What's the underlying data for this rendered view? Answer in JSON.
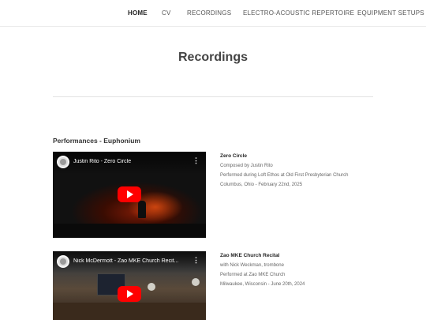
{
  "nav": {
    "items": [
      {
        "label": "HOME",
        "active": true
      },
      {
        "label": "CV",
        "active": false
      },
      {
        "label": "RECORDINGS",
        "active": false
      },
      {
        "label": "ELECTRO-ACOUSTIC REPERTOIRE",
        "active": false
      },
      {
        "label": "EQUIPMENT SETUPS",
        "active": false
      }
    ]
  },
  "page": {
    "title": "Recordings"
  },
  "section": {
    "heading": "Performances - Euphonium"
  },
  "videos": [
    {
      "player_title": "Justin Rito - Zero Circle",
      "title": "Zero Circle",
      "lines": [
        "Composed by Justin Rito",
        "Performed during Loft Ethos at Old First Presbyterian Church",
        "Columbus, Ohio - February 22nd, 2025"
      ]
    },
    {
      "player_title": "Nick McDermott - Zao MKE Church Recit...",
      "title": "Zao MKE Church Recital",
      "lines": [
        "with Nick Weckman, trombone",
        "Performed at Zao MKE Church",
        "Milwaukee, Wisconsin - June 20th, 2024"
      ]
    }
  ],
  "colors": {
    "play_button": "#ff0000",
    "accent_text": "#222222"
  },
  "icons": {
    "menu": "more-vert-icon",
    "play": "play-icon",
    "avatar": "channel-avatar"
  }
}
